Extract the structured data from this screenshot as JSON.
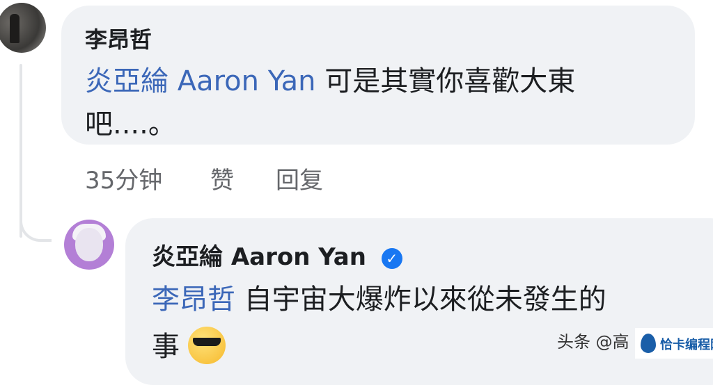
{
  "comment1": {
    "author": "李昂哲",
    "mention": "炎亞綸 Aaron Yan",
    "text_line1": "可是其實你喜歡大東",
    "text_line2": "吧....。",
    "time": "35分钟",
    "like_label": "赞",
    "reply_label": "回复"
  },
  "reply1": {
    "author": "炎亞綸 Aaron Yan",
    "verified_icon": "verified-check-icon",
    "mention": "李昂哲",
    "text_line1": "自宇宙大爆炸以來從未發生的",
    "text_line2": "事",
    "emoji": "sunglasses-emoji"
  },
  "watermark": {
    "left_text": "头条 @高",
    "right_text": "恰卡编程网"
  },
  "colors": {
    "bubble": "#f0f2f5",
    "mention": "#3b67b8",
    "meta": "#65676b",
    "verified": "#1877f2"
  }
}
